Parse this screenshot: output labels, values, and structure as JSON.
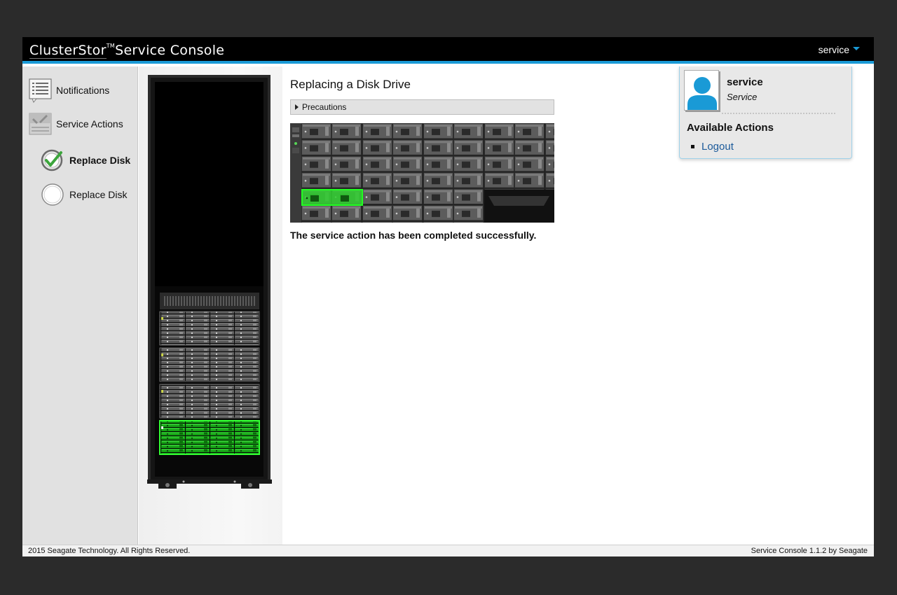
{
  "header": {
    "brand": "ClusterStor",
    "brand_tm": "TM",
    "brand_suffix": "Service Console",
    "user_menu_label": "service"
  },
  "sidebar": {
    "items": [
      {
        "label": "Notifications",
        "icon": "notifications-list-icon"
      },
      {
        "label": "Service Actions",
        "icon": "service-actions-icon"
      }
    ],
    "sub_items": [
      {
        "label": "Replace Disk",
        "status": "completed",
        "icon": "check-circle-icon"
      },
      {
        "label": "Replace Disk",
        "status": "pending",
        "icon": "empty-circle-icon"
      }
    ]
  },
  "main": {
    "title": "Replacing a Disk Drive",
    "precautions_label": "Precautions",
    "success_message": "The service action has been completed successfully."
  },
  "user_popup": {
    "name": "service",
    "role": "Service",
    "actions_title": "Available Actions",
    "actions": [
      "Logout"
    ]
  },
  "footer": {
    "left": "2015 Seagate Technology. All Rights Reserved.",
    "right": "Service Console 1.1.2 by Seagate"
  },
  "colors": {
    "accent": "#1a9ad6",
    "highlight_green": "#22cc22",
    "link": "#1b5a9a"
  }
}
